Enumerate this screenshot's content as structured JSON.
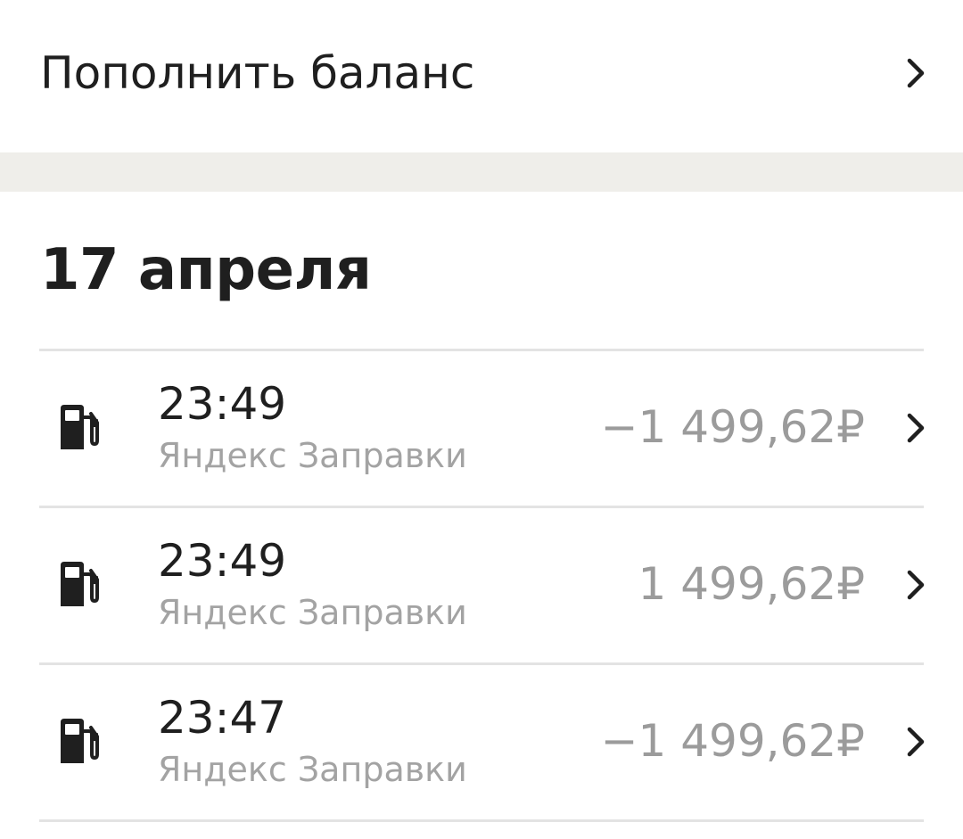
{
  "topup": {
    "label": "Пополнить баланс",
    "chevron_icon": "chevron-right-icon"
  },
  "colors": {
    "text_primary": "#1f1f1f",
    "text_secondary": "#a3a3a3",
    "amount": "#9b9b9b",
    "separator_band": "#efeeea",
    "divider": "#e3e3e3"
  },
  "section": {
    "date": "17 апреля"
  },
  "transactions": [
    {
      "icon": "fuel-pump-icon",
      "time": "23:49",
      "merchant": "Яндекс Заправки",
      "amount": "−1 499,62₽"
    },
    {
      "icon": "fuel-pump-icon",
      "time": "23:49",
      "merchant": "Яндекс Заправки",
      "amount": "1 499,62₽"
    },
    {
      "icon": "fuel-pump-icon",
      "time": "23:47",
      "merchant": "Яндекс Заправки",
      "amount": "−1 499,62₽"
    }
  ]
}
